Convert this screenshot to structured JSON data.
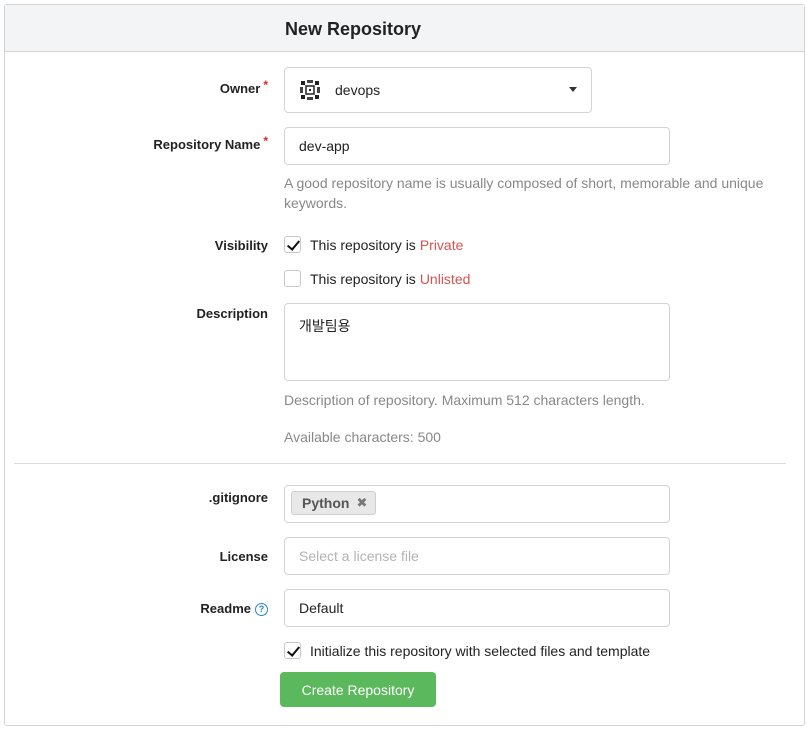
{
  "header": {
    "title": "New Repository"
  },
  "owner": {
    "label": "Owner",
    "required_mark": "*",
    "value": "devops",
    "avatar_icon": "org-avatar-icon"
  },
  "repo_name": {
    "label": "Repository Name",
    "required_mark": "*",
    "value": "dev-app",
    "help": "A good repository name is usually composed of short, memorable and unique keywords."
  },
  "visibility": {
    "label": "Visibility",
    "private": {
      "text": "This repository is",
      "accent": "Private",
      "checked": true
    },
    "unlisted": {
      "text": "This repository is",
      "accent": "Unlisted",
      "checked": false
    },
    "accent_color": "#d9534f"
  },
  "description": {
    "label": "Description",
    "value": "개발팀용",
    "help": "Description of repository. Maximum 512 characters length.",
    "available": "Available characters: 500"
  },
  "gitignore": {
    "label": ".gitignore",
    "selected": [
      "Python"
    ]
  },
  "license": {
    "label": "License",
    "placeholder": "Select a license file"
  },
  "readme": {
    "label": "Readme",
    "value": "Default",
    "help_icon": "question-circle-icon"
  },
  "init": {
    "text": "Initialize this repository with selected files and template",
    "checked": true
  },
  "submit": {
    "label": "Create Repository",
    "color": "#5cb85c"
  }
}
